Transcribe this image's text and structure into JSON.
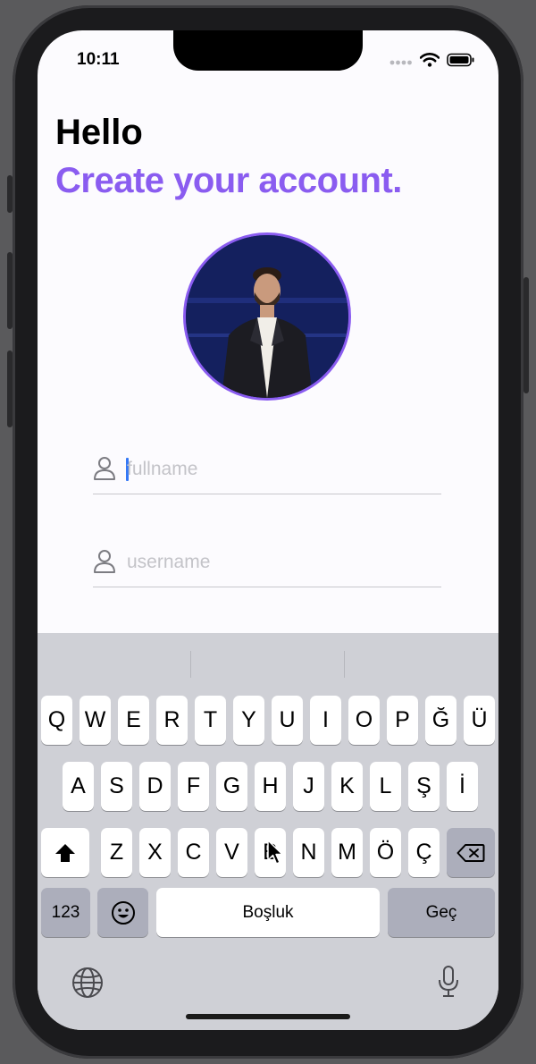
{
  "status_bar": {
    "time": "10:11"
  },
  "header": {
    "greeting": "Hello",
    "subtitle": "Create your account."
  },
  "form": {
    "fullname": {
      "placeholder": "fullname"
    },
    "username": {
      "placeholder": "username"
    }
  },
  "keyboard": {
    "row1": [
      "Q",
      "W",
      "E",
      "R",
      "T",
      "Y",
      "U",
      "I",
      "O",
      "P",
      "Ğ",
      "Ü"
    ],
    "row2": [
      "A",
      "S",
      "D",
      "F",
      "G",
      "H",
      "J",
      "K",
      "L",
      "Ş",
      "İ"
    ],
    "row3": [
      "Z",
      "X",
      "C",
      "V",
      "B",
      "N",
      "M",
      "Ö",
      "Ç"
    ],
    "numbers_label": "123",
    "space_label": "Boşluk",
    "return_label": "Geç"
  },
  "icons": [
    "person-icon",
    "shift-icon",
    "backspace-icon",
    "emoji-icon",
    "globe-icon",
    "microphone-icon",
    "wifi-icon",
    "battery-icon",
    "signal-icon"
  ],
  "colors": {
    "accent": "#8a5cf0",
    "caret": "#3478f6",
    "keyboard_bg": "#cfd0d6"
  }
}
